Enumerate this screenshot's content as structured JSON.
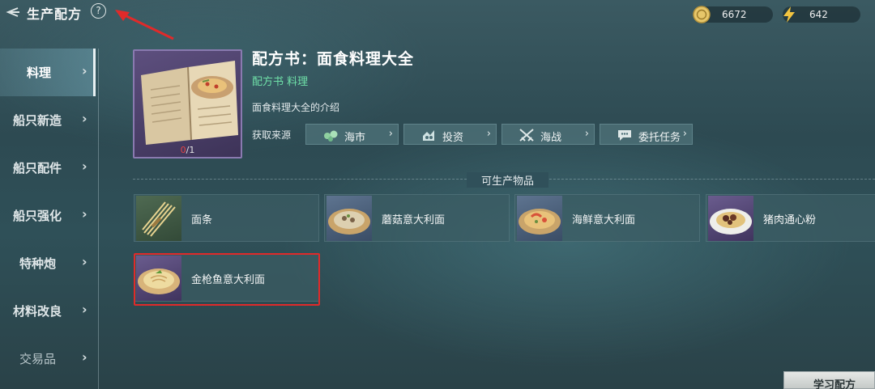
{
  "header": {
    "title": "生产配方",
    "help": "?"
  },
  "currency": {
    "gold": "6672",
    "energy": "642"
  },
  "sidebar": {
    "items": [
      {
        "label": "料理"
      },
      {
        "label": "船只新造"
      },
      {
        "label": "船只配件"
      },
      {
        "label": "船只强化"
      },
      {
        "label": "特种炮"
      },
      {
        "label": "材料改良"
      },
      {
        "label": "交易品"
      }
    ]
  },
  "recipe": {
    "title": "配方书：面食料理大全",
    "tags": "配方书 料理",
    "description": "面食料理大全的介绍",
    "count_current": "0",
    "count_total": "/1",
    "source_label": "获取来源",
    "sources": [
      {
        "label": "海市",
        "icon": "market-icon"
      },
      {
        "label": "投资",
        "icon": "investment-icon"
      },
      {
        "label": "海战",
        "icon": "crossed-swords-icon"
      },
      {
        "label": "委托任务",
        "icon": "chat-bubble-icon"
      }
    ]
  },
  "producible": {
    "title": "可生产物品",
    "items": [
      {
        "name": "面条"
      },
      {
        "name": "蘑菇意大利面"
      },
      {
        "name": "海鲜意大利面"
      },
      {
        "name": "猪肉通心粉"
      },
      {
        "name": "金枪鱼意大利面"
      }
    ]
  },
  "actions": {
    "learn": "学习配方"
  },
  "colors": {
    "accent_green": "#6fe0a8",
    "highlight_red": "#e02a2a",
    "arrow_red": "#e02a2a"
  }
}
